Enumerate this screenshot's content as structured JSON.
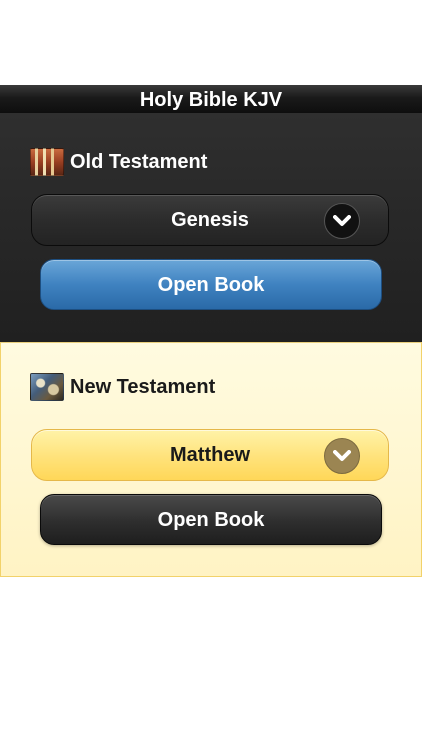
{
  "app": {
    "title": "Holy Bible KJV"
  },
  "old_testament": {
    "heading": "Old Testament",
    "thumbnail_icon": "old-testament-thumbnail",
    "selected_book": "Genesis",
    "open_label": "Open Book",
    "accent": "#3f82c0"
  },
  "new_testament": {
    "heading": "New Testament",
    "thumbnail_icon": "new-testament-thumbnail",
    "selected_book": "Matthew",
    "open_label": "Open Book",
    "accent": "#ffe27a"
  }
}
